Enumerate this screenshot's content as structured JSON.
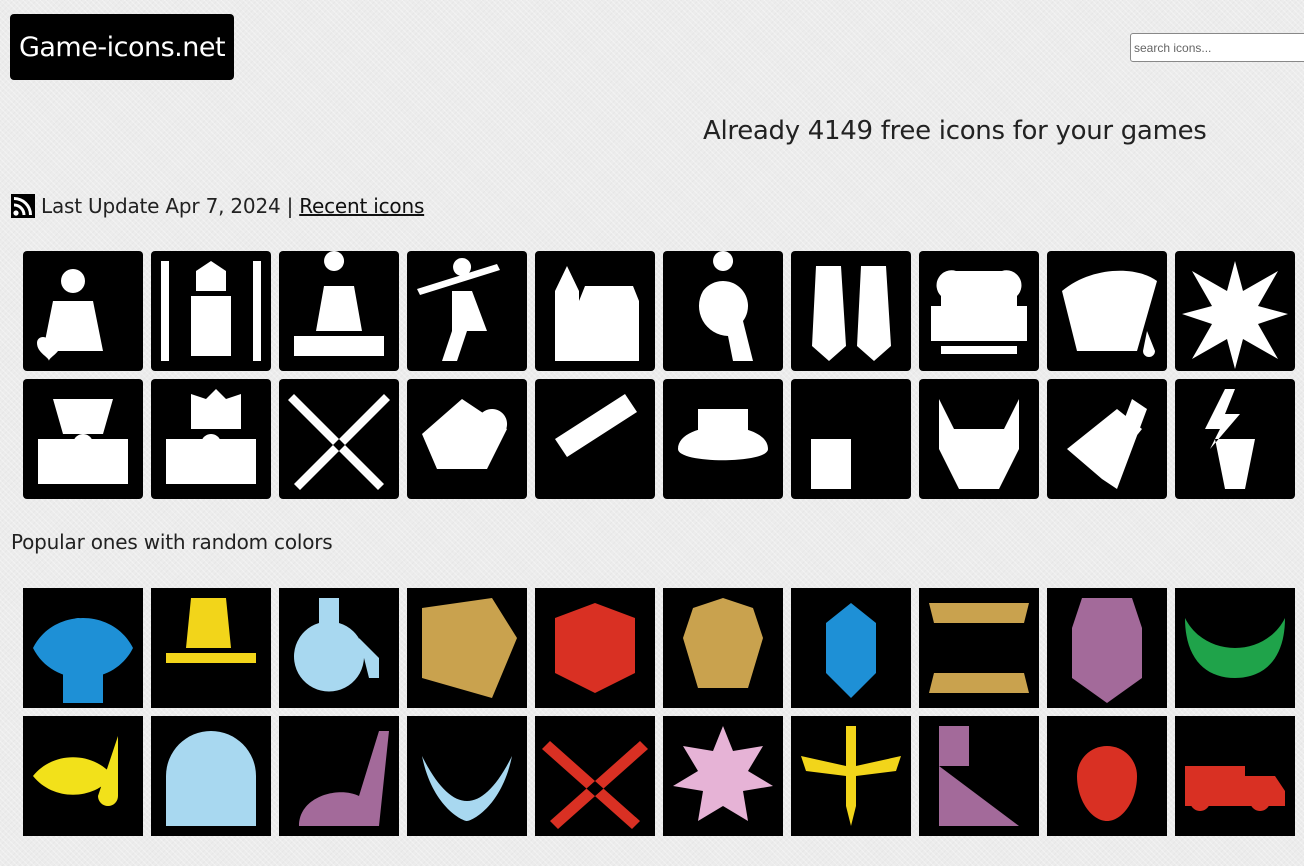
{
  "header": {
    "logo_text": "Game-icons.net",
    "search_placeholder": "search icons..."
  },
  "tagline": "Already 4149 free icons for your games",
  "update": {
    "text": "Last Update Apr 7, 2024 |",
    "link_label": "Recent icons"
  },
  "recent_icons": [
    {
      "name": "seated-lady-heart-icon",
      "color": "#ffffff"
    },
    {
      "name": "jester-throne-icon",
      "color": "#ffffff"
    },
    {
      "name": "merchant-table-icon",
      "color": "#ffffff"
    },
    {
      "name": "bindle-traveler-icon",
      "color": "#ffffff"
    },
    {
      "name": "timber-house-icon",
      "color": "#ffffff"
    },
    {
      "name": "dodo-bird-icon",
      "color": "#ffffff"
    },
    {
      "name": "feathers-icon",
      "color": "#ffffff"
    },
    {
      "name": "armchair-icon",
      "color": "#ffffff"
    },
    {
      "name": "leaking-sack-icon",
      "color": "#ffffff"
    },
    {
      "name": "spiky-explosion-icon",
      "color": "#ffffff"
    },
    {
      "name": "radioactive-box-creature-icon",
      "color": "#ffffff"
    },
    {
      "name": "cat-in-radioactive-box-icon",
      "color": "#ffffff"
    },
    {
      "name": "crossed-crooks-icon",
      "color": "#ffffff"
    },
    {
      "name": "bucket-wheel-excavator-icon",
      "color": "#ffffff"
    },
    {
      "name": "telescope-icon",
      "color": "#ffffff"
    },
    {
      "name": "boater-hat-icon",
      "color": "#ffffff"
    },
    {
      "name": "oil-can-icon",
      "color": "#ffffff"
    },
    {
      "name": "horned-helmet-icon",
      "color": "#ffffff"
    },
    {
      "name": "hand-holding-vial-icon",
      "color": "#ffffff"
    },
    {
      "name": "lightning-pedestal-icon",
      "color": "#ffffff"
    }
  ],
  "popular_title": "Popular ones with random colors",
  "popular_icons": [
    {
      "name": "eye-figure-icon",
      "color": "#1e90d6"
    },
    {
      "name": "boot-lightning-icon",
      "color": "#f2d51a"
    },
    {
      "name": "potion-flask-icon",
      "color": "#a8d8f0"
    },
    {
      "name": "skull-in-rock-icon",
      "color": "#c9a24e"
    },
    {
      "name": "dice-icon",
      "color": "#d93023"
    },
    {
      "name": "alien-face-icon",
      "color": "#c9a24e"
    },
    {
      "name": "viking-head-icon",
      "color": "#1e90d6"
    },
    {
      "name": "fangs-icon",
      "color": "#c9a24e"
    },
    {
      "name": "cyborg-face-icon",
      "color": "#a36a9a"
    },
    {
      "name": "slime-face-icon",
      "color": "#1fa34a"
    },
    {
      "name": "fish-hook-icon",
      "color": "#f2e11a"
    },
    {
      "name": "astronaut-helmet-icon",
      "color": "#a8d8f0"
    },
    {
      "name": "dinosaur-icon",
      "color": "#a36a9a"
    },
    {
      "name": "evil-face-icon",
      "color": "#a8d8f0"
    },
    {
      "name": "crossed-sabers-icon",
      "color": "#d93023"
    },
    {
      "name": "gem-sun-icon",
      "color": "#e6b3d6"
    },
    {
      "name": "winged-sword-icon",
      "color": "#f2d51a"
    },
    {
      "name": "window-wall-icon",
      "color": "#a36a9a"
    },
    {
      "name": "hatching-chick-icon",
      "color": "#d93023"
    },
    {
      "name": "dump-truck-icon",
      "color": "#d93023"
    }
  ]
}
